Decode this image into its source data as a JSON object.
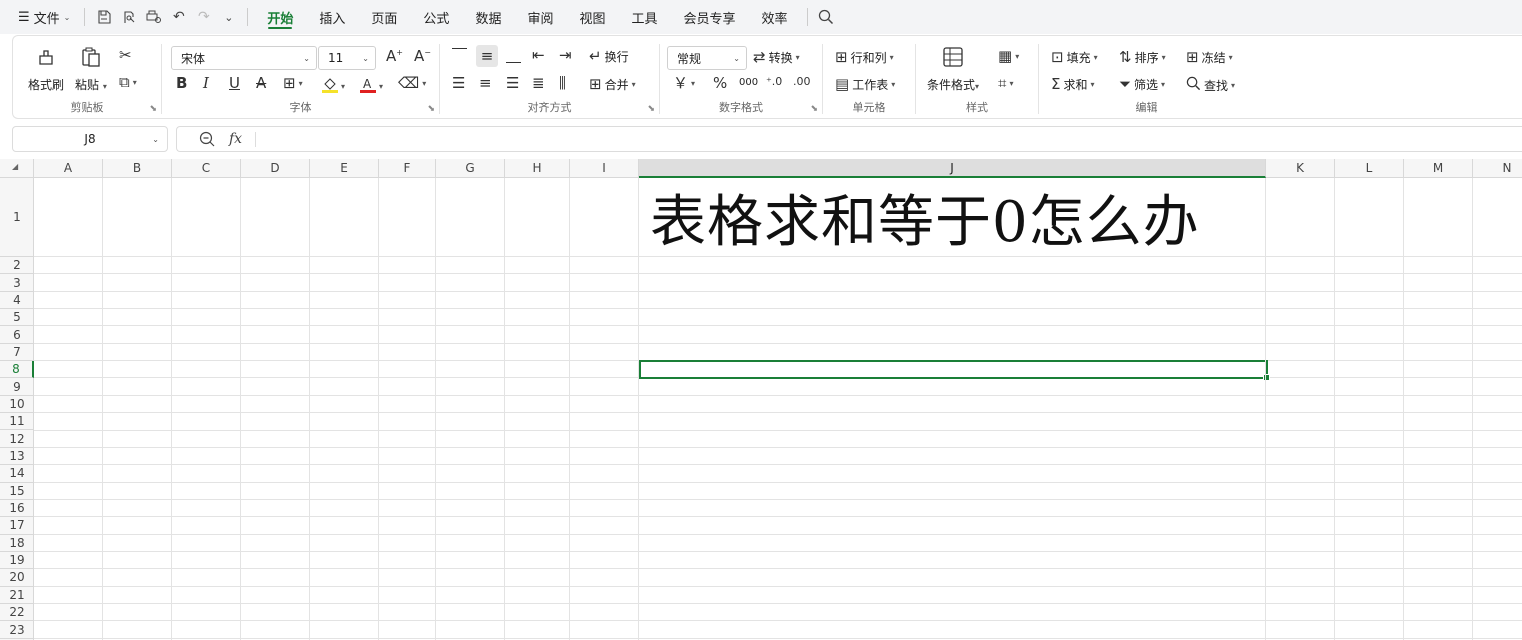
{
  "menubar": {
    "file_label": "文件",
    "tabs": [
      "开始",
      "插入",
      "页面",
      "公式",
      "数据",
      "审阅",
      "视图",
      "工具",
      "会员专享",
      "效率"
    ],
    "active_tab": "开始"
  },
  "ribbon": {
    "clipboard": {
      "title": "剪贴板",
      "format_painter": "格式刷",
      "paste": "粘贴"
    },
    "font": {
      "title": "字体",
      "font_name": "宋体",
      "font_size": "11"
    },
    "alignment": {
      "title": "对齐方式",
      "wrap": "换行",
      "merge": "合并"
    },
    "number": {
      "title": "数字格式",
      "format": "常规",
      "convert": "转换",
      "currency": "￥",
      "percent": "%",
      "thousands": "000"
    },
    "cells": {
      "title": "单元格",
      "rows_cols": "行和列",
      "worksheet": "工作表"
    },
    "styles": {
      "title": "样式",
      "conditional": "条件格式"
    },
    "editing": {
      "title": "编辑",
      "fill": "填充",
      "sort": "排序",
      "freeze": "冻结",
      "sum": "求和",
      "filter": "筛选",
      "find": "查找"
    }
  },
  "formula_bar": {
    "name_box": "J8",
    "fx": "fx",
    "formula": ""
  },
  "grid": {
    "columns": [
      "A",
      "B",
      "C",
      "D",
      "E",
      "F",
      "G",
      "H",
      "I",
      "J",
      "K",
      "L",
      "M",
      "N"
    ],
    "rows": [
      "1",
      "2",
      "3",
      "4",
      "5",
      "6",
      "7",
      "8",
      "9",
      "10",
      "11",
      "12",
      "13",
      "14",
      "15",
      "16",
      "17",
      "18",
      "19",
      "20",
      "21",
      "22",
      "23"
    ],
    "selected_column": "J",
    "selected_row": "8",
    "cell_J1": "表格求和等于0怎么办"
  },
  "colors": {
    "accent": "#1a7f37",
    "fill_color": "#f5e22a",
    "font_color": "#e02020"
  }
}
